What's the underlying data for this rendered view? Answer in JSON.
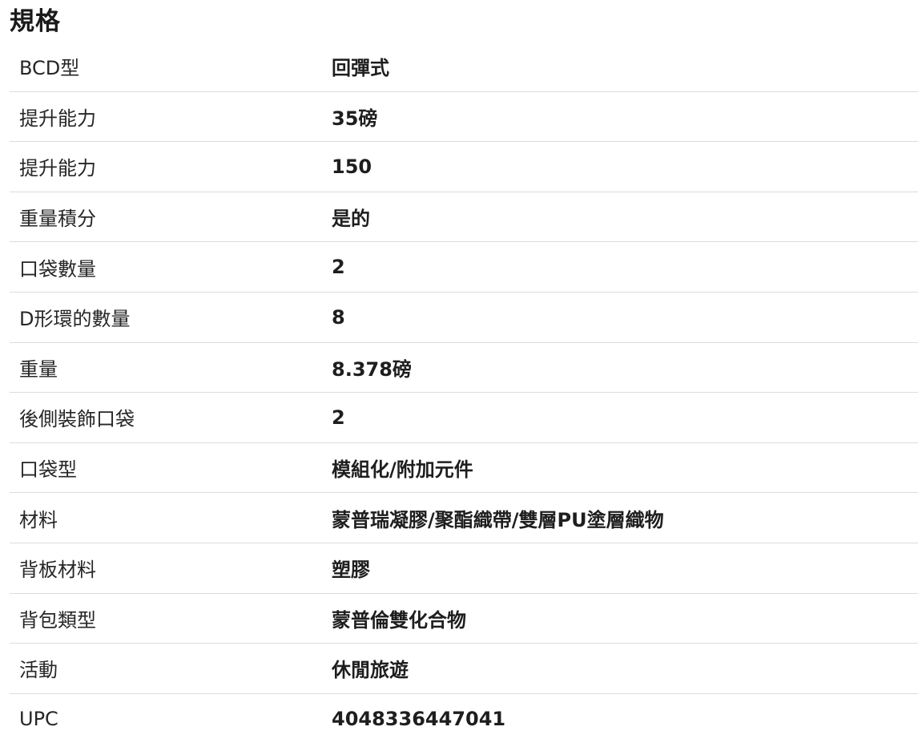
{
  "section": {
    "title": "規格"
  },
  "specs": [
    {
      "label": "BCD型",
      "value": "回彈式"
    },
    {
      "label": "提升能力",
      "value": "35磅"
    },
    {
      "label": "提升能力",
      "value": "150"
    },
    {
      "label": "重量積分",
      "value": "是的"
    },
    {
      "label": "口袋數量",
      "value": "2"
    },
    {
      "label": "D形環的數量",
      "value": "8"
    },
    {
      "label": "重量",
      "value": "8.378磅"
    },
    {
      "label": "後側裝飾口袋",
      "value": "2"
    },
    {
      "label": "口袋型",
      "value": "模組化/附加元件"
    },
    {
      "label": "材料",
      "value": "蒙普瑞凝膠/聚酯織帶/雙層PU塗層織物"
    },
    {
      "label": "背板材料",
      "value": "塑膠"
    },
    {
      "label": "背包類型",
      "value": "蒙普倫雙化合物"
    },
    {
      "label": "活動",
      "value": "休閒旅遊"
    },
    {
      "label": "UPC",
      "value": "4048336447041"
    }
  ]
}
